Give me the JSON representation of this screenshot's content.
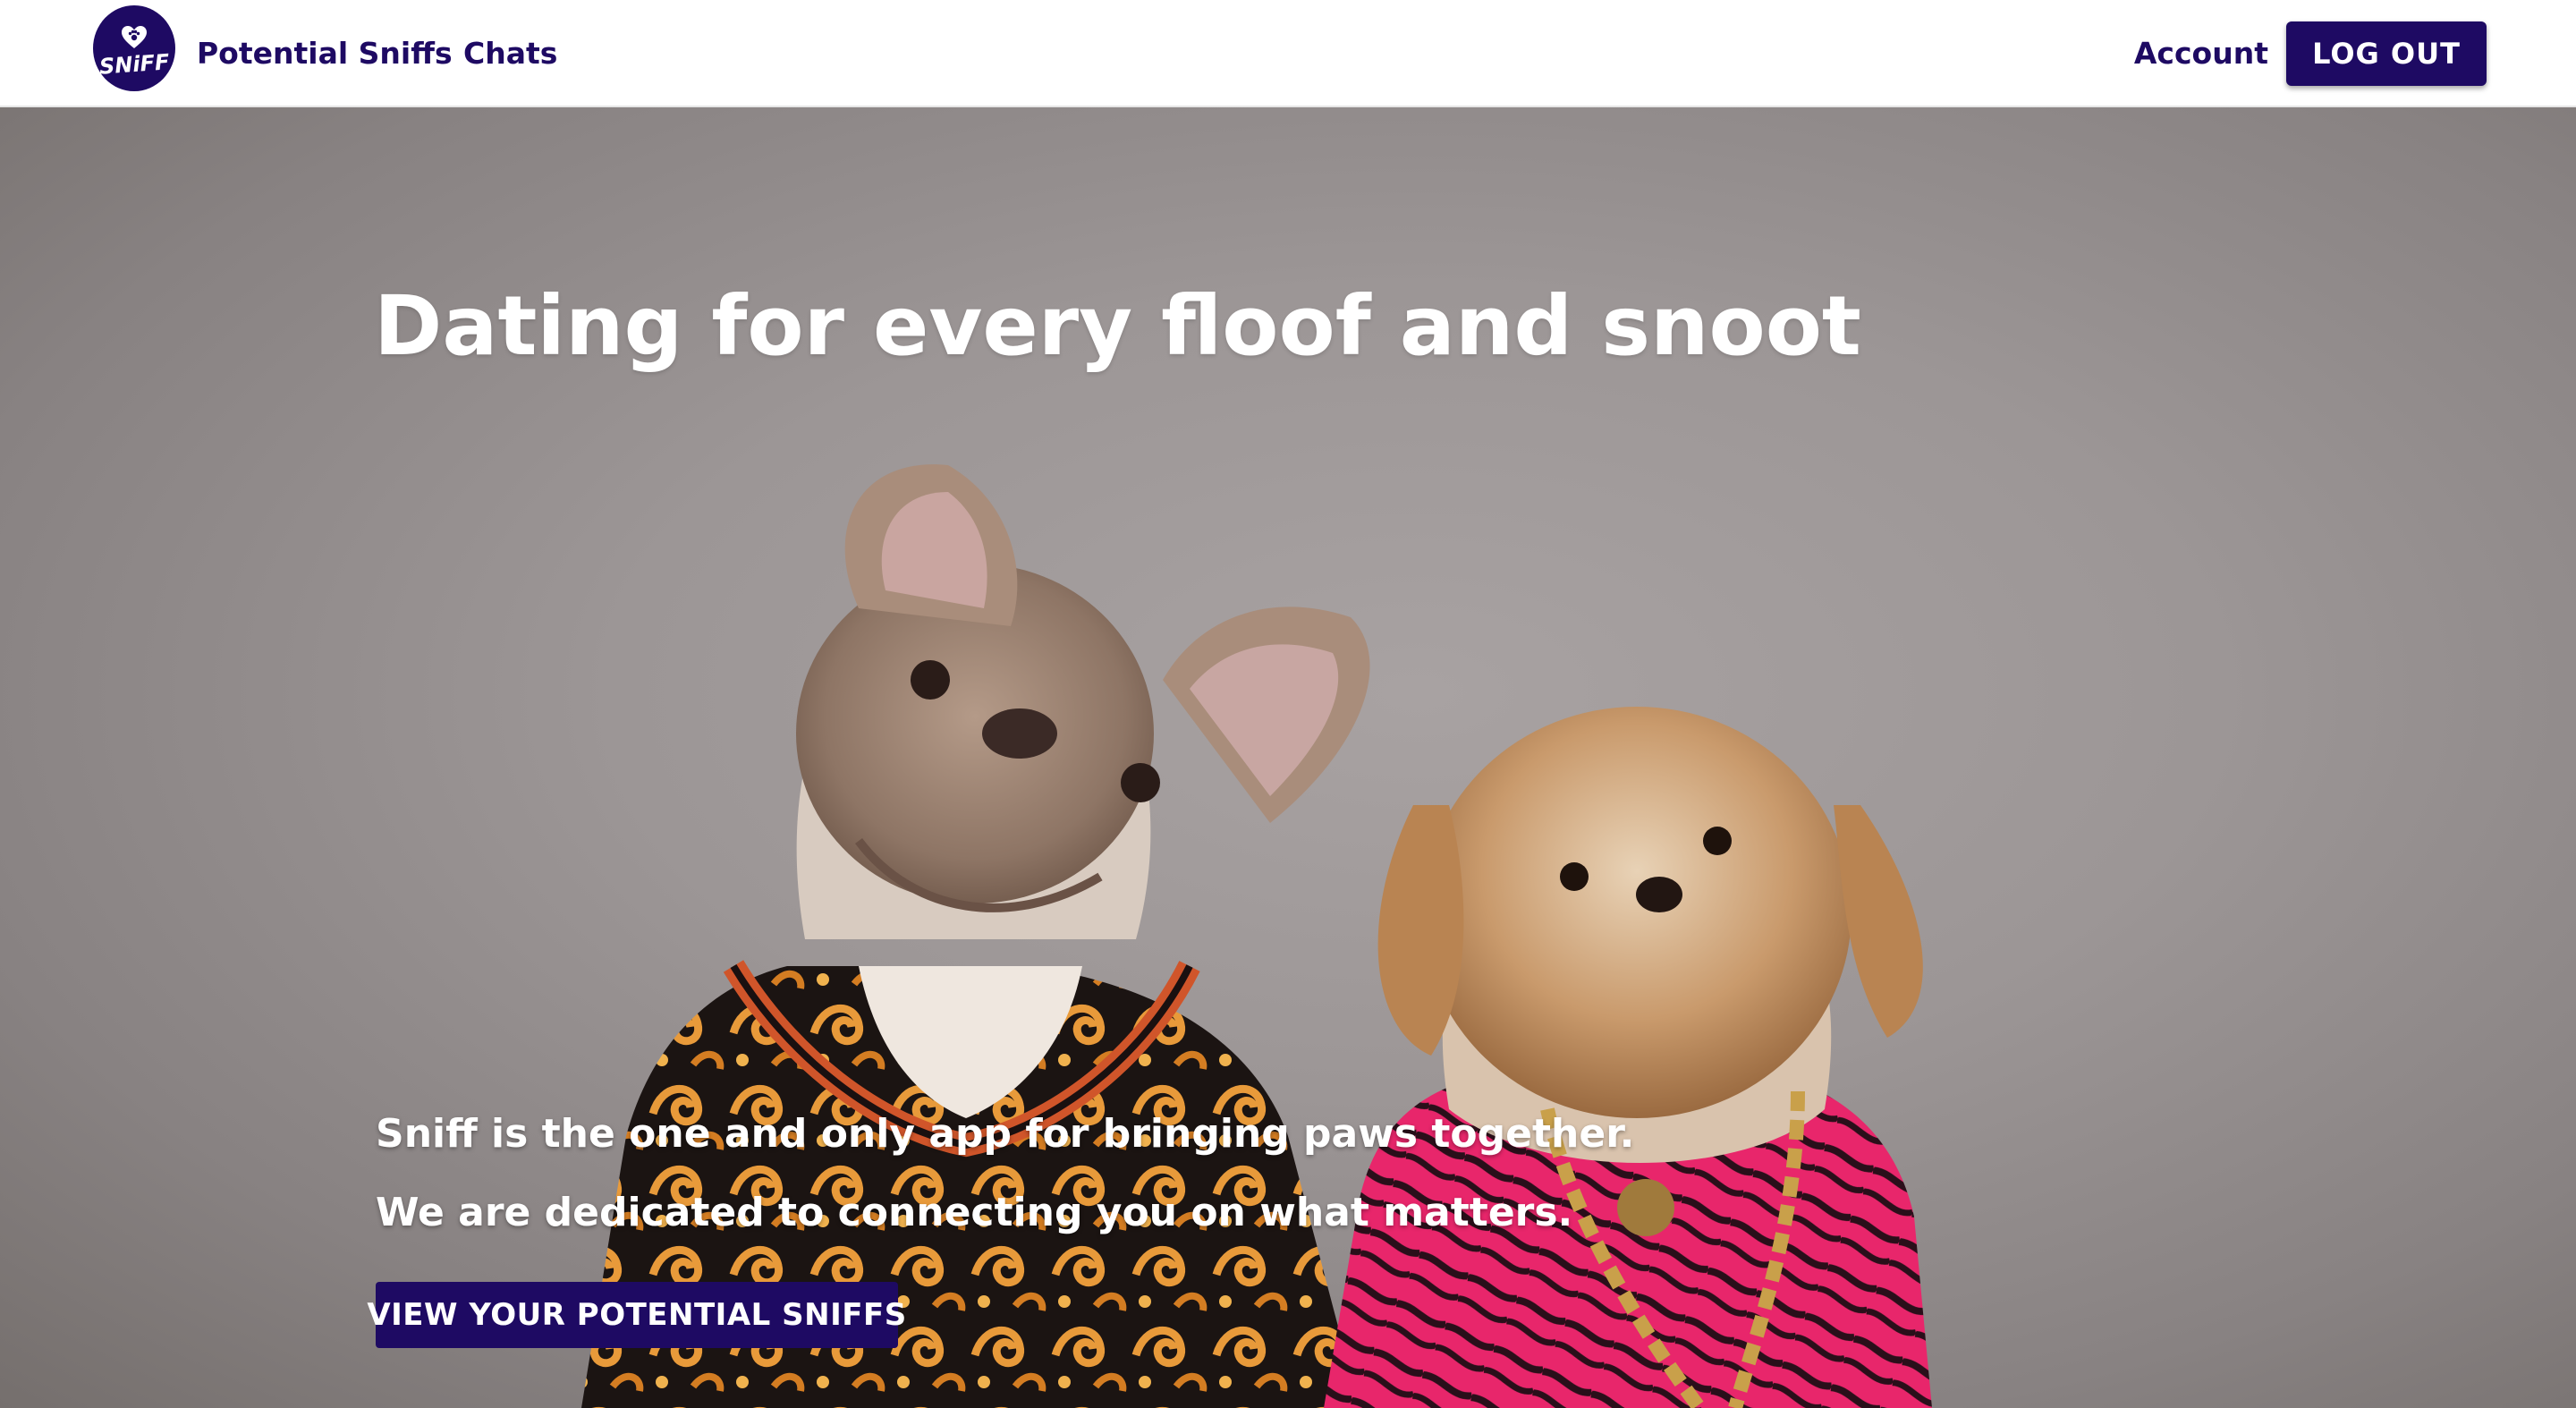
{
  "brand": {
    "logo_text": "SNiFF",
    "logo_icon": "heart-paw-icon",
    "primary_color": "#1e0a63"
  },
  "nav": {
    "links": [
      {
        "label": "Potential Sniffs"
      },
      {
        "label": "Chats"
      }
    ],
    "account_label": "Account",
    "logout_label": "LOG OUT"
  },
  "hero": {
    "title": "Dating for every floof and snoot",
    "lines": [
      "Sniff is the one and only app for bringing paws together.",
      "We are dedicated to connecting you on what matters."
    ],
    "cta_label": "VIEW YOUR POTENTIAL SNIFFS"
  }
}
